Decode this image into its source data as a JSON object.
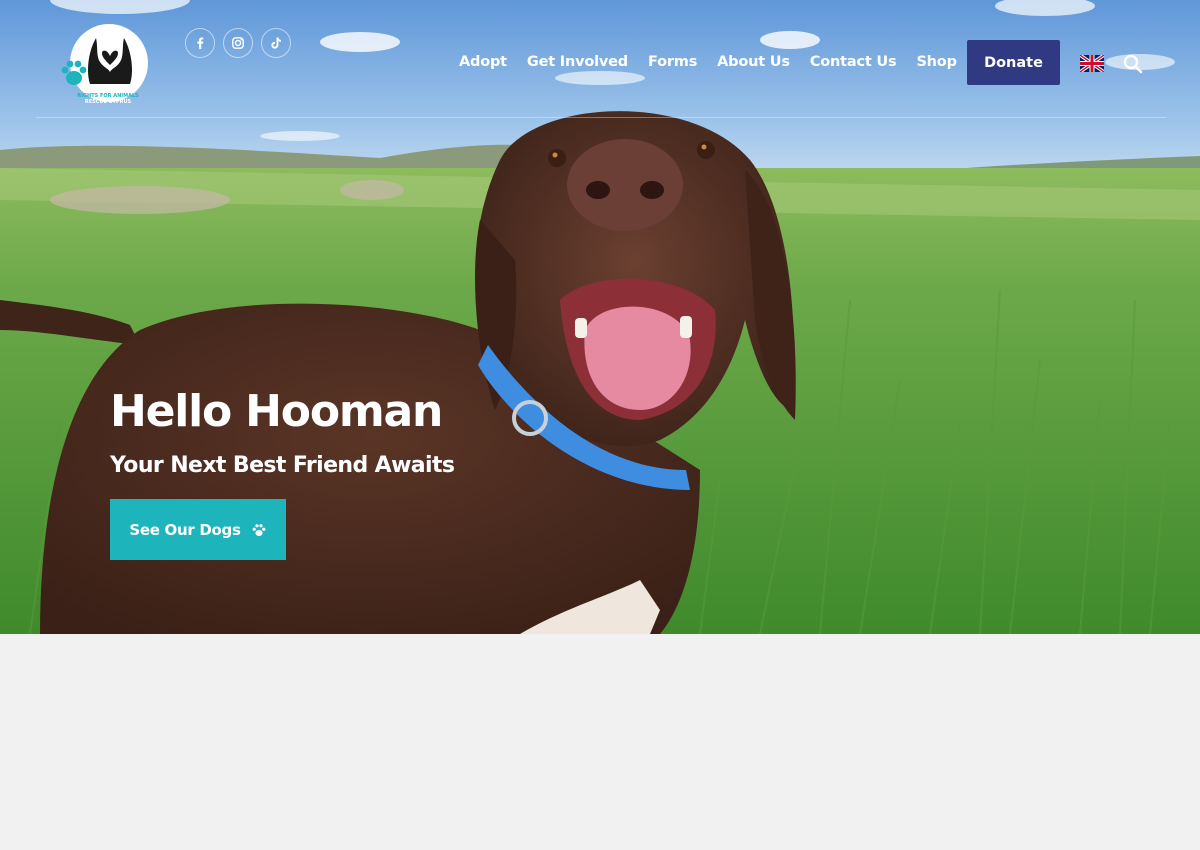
{
  "brand": {
    "logo_text_line1": "RIGHTS FOR ANIMALS",
    "logo_text_line2": "RESCUE CYPRUS",
    "accent": "#1eb4bc",
    "primary": "#2f3a82"
  },
  "social": [
    {
      "icon": "facebook-icon"
    },
    {
      "icon": "instagram-icon"
    },
    {
      "icon": "tiktok-icon"
    }
  ],
  "nav": {
    "items": [
      "Adopt",
      "Get Involved",
      "Forms",
      "About Us",
      "Contact Us",
      "Shop"
    ],
    "donate_label": "Donate",
    "language_icon": "uk-flag-icon",
    "search_icon": "search-icon"
  },
  "hero": {
    "title": "Hello Hooman",
    "subtitle": "Your Next Best Friend Awaits",
    "cta_label": "See Our Dogs",
    "cta_icon": "paw-icon"
  },
  "colors": {
    "page_background": "#f1f1f1",
    "cta_background": "#1eb4bc",
    "donate_background": "#2f3a82"
  }
}
